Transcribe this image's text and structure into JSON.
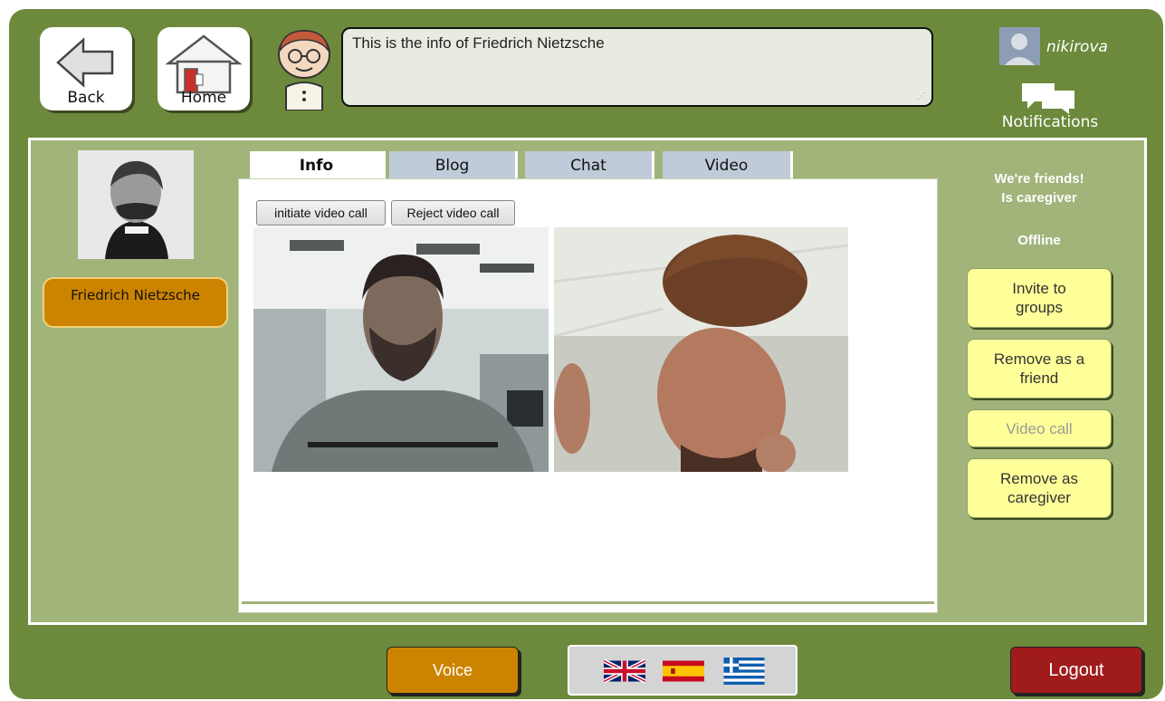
{
  "header": {
    "back_label": "Back",
    "home_label": "Home",
    "speech_text": "This is the info of Friedrich Nietzsche",
    "username": "nikirova",
    "notifications_label": "Notifications"
  },
  "profile": {
    "name": "Friedrich Nietzsche"
  },
  "tabs": [
    {
      "label": "Info",
      "active": true
    },
    {
      "label": "Blog",
      "active": false
    },
    {
      "label": "Chat",
      "active": false
    },
    {
      "label": "Video",
      "active": false
    }
  ],
  "video_panel": {
    "initiate_label": "initiate video call",
    "reject_label": "Reject video call"
  },
  "status": {
    "friends": "We're friends!",
    "caregiver": "Is caregiver",
    "online": "Offline"
  },
  "actions": {
    "invite": "Invite to groups",
    "remove_friend": "Remove as a friend",
    "video_call": "Video call",
    "remove_caregiver": "Remove as caregiver"
  },
  "footer": {
    "voice_label": "Voice",
    "logout_label": "Logout",
    "languages": [
      "english-flag-icon",
      "spanish-flag-icon",
      "greek-flag-icon"
    ]
  },
  "colors": {
    "frame_green": "#6d8a3c",
    "panel_green": "#a1b47a",
    "orange": "#cc8400",
    "yellow_button": "#ffff99",
    "logout_red": "#a01c1c",
    "tab_blue": "#bfcbd8"
  }
}
